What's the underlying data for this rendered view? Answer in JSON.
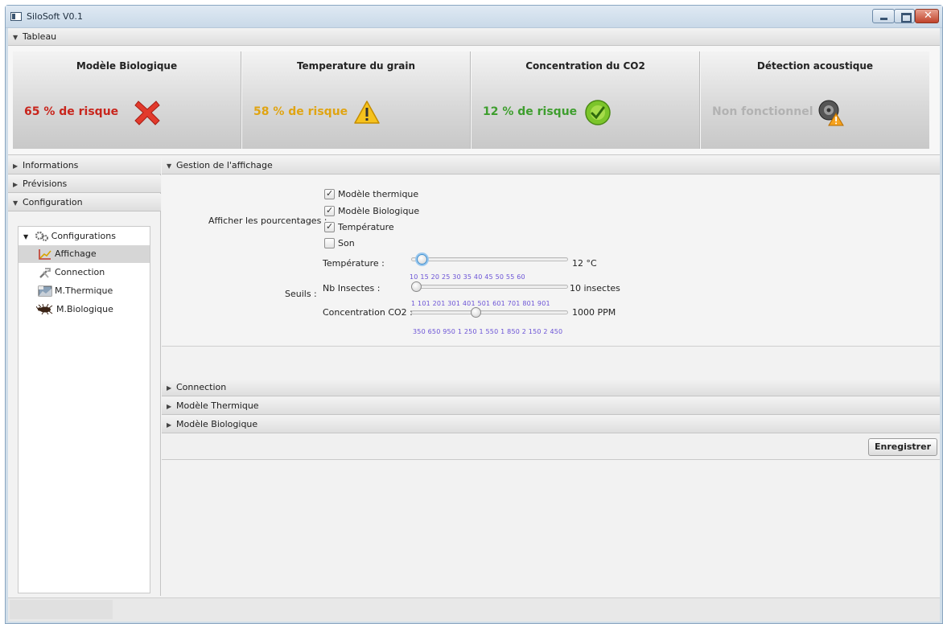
{
  "window": {
    "title": "SiloSoft V0.1"
  },
  "dashboard": {
    "header": "Tableau",
    "cards": [
      {
        "title": "Modèle Biologique",
        "value": "65 % de risque",
        "color": "#c8251c",
        "icon": "error-cross-icon"
      },
      {
        "title": "Temperature du grain",
        "value": "58 % de risque",
        "color": "#e0a412",
        "icon": "warning-triangle-icon"
      },
      {
        "title": "Concentration du CO2",
        "value": "12 % de risque",
        "color": "#3e9e2e",
        "icon": "ok-check-icon"
      },
      {
        "title": "Détection acoustique",
        "value": "Non fonctionnel",
        "color": "#b2b2b2",
        "icon": "speaker-warning-icon"
      }
    ]
  },
  "sidebar": {
    "sections": [
      {
        "label": "Informations",
        "expanded": false
      },
      {
        "label": "Prévisions",
        "expanded": false
      },
      {
        "label": "Configuration",
        "expanded": true
      }
    ],
    "tree": {
      "root": "Configurations",
      "items": [
        {
          "label": "Affichage",
          "selected": true,
          "icon": "chart-icon"
        },
        {
          "label": "Connection",
          "selected": false,
          "icon": "tools-icon"
        },
        {
          "label": "M.Thermique",
          "selected": false,
          "icon": "thermal-image-icon"
        },
        {
          "label": "M.Biologique",
          "selected": false,
          "icon": "insect-icon"
        }
      ]
    }
  },
  "main": {
    "display_pane": {
      "header": "Gestion de l'affichage",
      "percent_label": "Afficher les pourcentages :",
      "checkboxes": [
        {
          "label": "Modèle thermique",
          "checked": true
        },
        {
          "label": "Modèle Biologique",
          "checked": true
        },
        {
          "label": "Température",
          "checked": true
        },
        {
          "label": "Son",
          "checked": false
        }
      ],
      "thresholds_label": "Seuils :",
      "sliders": [
        {
          "label": "Température :",
          "value_text": "12 °C",
          "value": 12,
          "min": 10,
          "max": 60,
          "ticks": ""
        },
        {
          "label": "Nb Insectes :",
          "value_text": "10 insectes",
          "value": 10,
          "min": 10,
          "max": 60,
          "ticks": "10   15   20   25   30   35   40   45   50   55   60"
        },
        {
          "label": "Concentration CO2 :",
          "value_text": "1000 PPM",
          "value": 1000,
          "min": 1,
          "max": 2450,
          "ticks": "1   101  201  301  401  501  601  701  801  901"
        }
      ],
      "bottom_ticks": "350     650     950    1 250  1 550  1 850  2 150  2 450"
    },
    "collapsed_panes": [
      "Connection",
      "Modèle Thermique",
      "Modèle Biologique"
    ],
    "save_label": "Enregistrer"
  }
}
